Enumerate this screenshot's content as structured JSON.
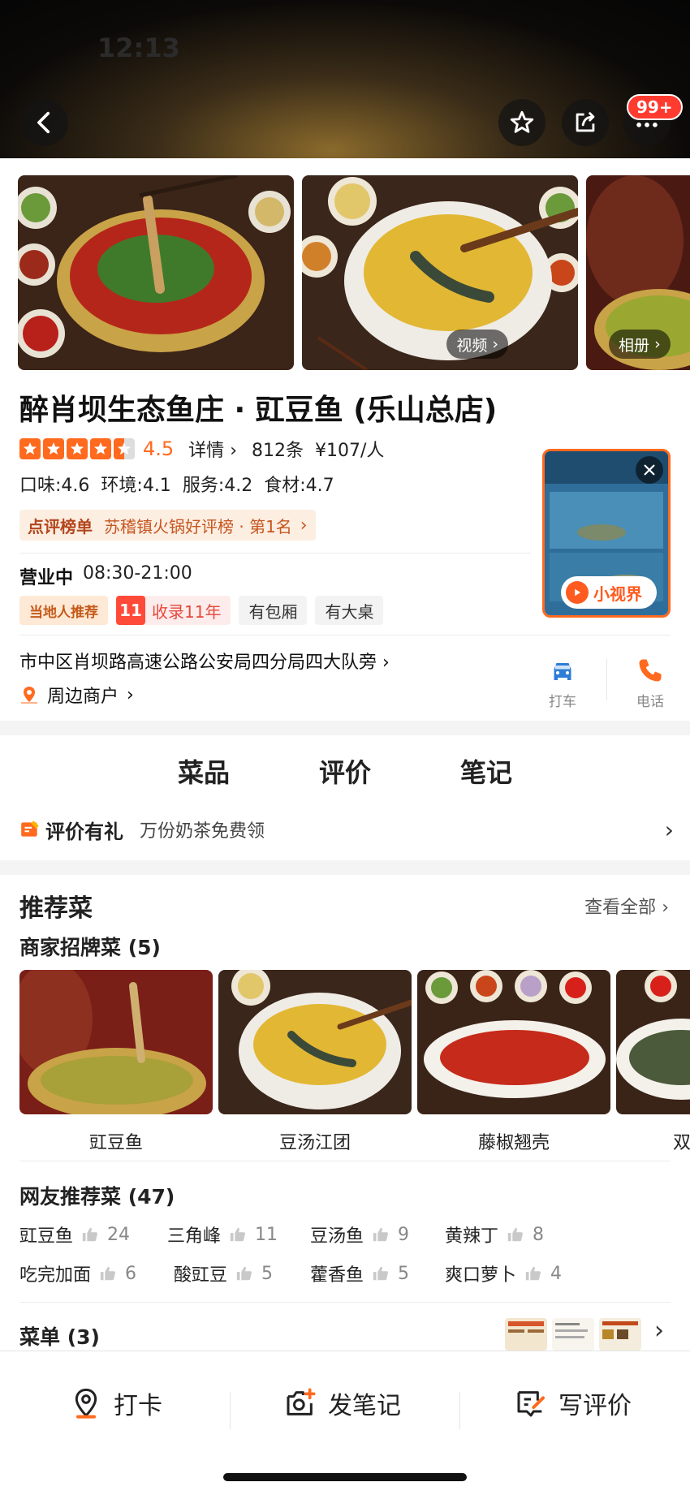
{
  "status": {
    "time": "12:13"
  },
  "header": {
    "badge": "99+"
  },
  "photos": {
    "video_label": "视频",
    "album_label": "相册"
  },
  "shop": {
    "name": "醉肖坝生态鱼庄 · 豇豆鱼 (乐山总店)",
    "rating": "4.5",
    "rating_value": 4.5,
    "details_label": "详情",
    "review_count": "812条",
    "price": "¥107/人",
    "scores": {
      "taste": "口味:4.6",
      "environment": "环境:4.1",
      "service": "服务:4.2",
      "ingredients": "食材:4.7"
    },
    "rank_tag": "点评榜单",
    "rank_text": "苏稽镇火锅好评榜 · 第1名",
    "status": "营业中",
    "hours": "08:30-21:00",
    "tags": {
      "local": "当地人推荐",
      "years_num": "11",
      "years_text": "收录11年",
      "private_room": "有包厢",
      "big_table": "有大桌"
    },
    "address": "市中区肖坝路高速公路公安局四分局四大队旁",
    "nearby": "周边商户",
    "actions": {
      "taxi": "打车",
      "phone": "电话"
    },
    "video_badge": "小视界"
  },
  "colors": {
    "accent": "#ff6a1f",
    "rank_text": "#c5561f",
    "badge": "#ff3b30"
  },
  "tabs": [
    {
      "label": "菜品",
      "active": true
    },
    {
      "label": "评价"
    },
    {
      "label": "笔记"
    }
  ],
  "promo": {
    "title": "评价有礼",
    "text": "万份奶茶免费领"
  },
  "dishes": {
    "title": "推荐菜",
    "see_all": "查看全部",
    "signature_title": "商家招牌菜 (5)",
    "signature": [
      {
        "name": "豇豆鱼"
      },
      {
        "name": "豆汤江团"
      },
      {
        "name": "藤椒翘壳"
      },
      {
        "name": "双"
      }
    ],
    "user_title": "网友推荐菜 (47)",
    "user": [
      {
        "name": "豇豆鱼",
        "count": "24"
      },
      {
        "name": "三角峰",
        "count": "11"
      },
      {
        "name": "豆汤鱼",
        "count": "9"
      },
      {
        "name": "黄辣丁",
        "count": "8"
      },
      {
        "name": "吃完加面",
        "count": "6"
      },
      {
        "name": "酸豇豆",
        "count": "5"
      },
      {
        "name": "藿香鱼",
        "count": "5"
      },
      {
        "name": "爽口萝卜",
        "count": "4"
      }
    ],
    "menu_title": "菜单 (3)"
  },
  "bottom": {
    "checkin": "打卡",
    "post_note": "发笔记",
    "write_review": "写评价"
  },
  "icons": [
    "back-icon",
    "star-icon",
    "share-icon",
    "more-icon",
    "taxi-icon",
    "phone-icon",
    "location-pin-icon",
    "camera-icon",
    "edit-icon",
    "thumb-up-icon",
    "chevron-right-icon",
    "close-icon",
    "play-icon",
    "gift-icon"
  ]
}
